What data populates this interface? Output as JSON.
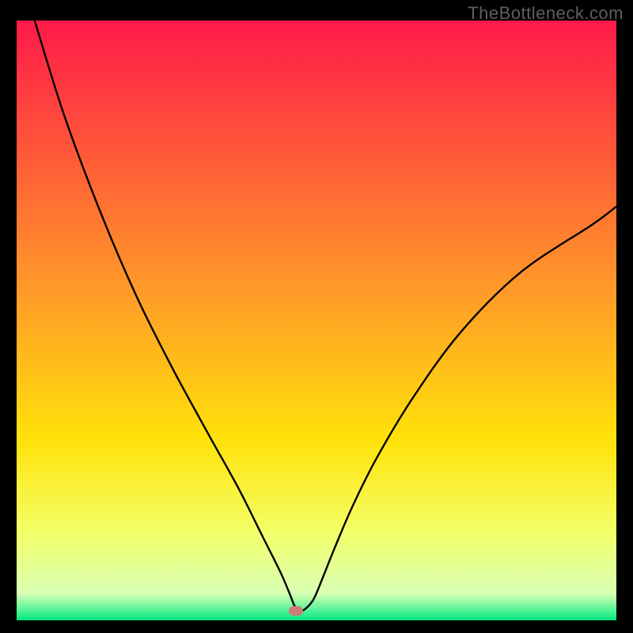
{
  "watermark": "TheBottleneck.com",
  "chart_data": {
    "type": "line",
    "title": "",
    "xlabel": "",
    "ylabel": "",
    "xlim": [
      0,
      100
    ],
    "ylim": [
      0,
      100
    ],
    "grid": false,
    "gradient_stops": [
      {
        "offset": 0,
        "color": "#ff1a49"
      },
      {
        "offset": 0.45,
        "color": "#ff9a28"
      },
      {
        "offset": 0.7,
        "color": "#ffe20a"
      },
      {
        "offset": 0.85,
        "color": "#f4ff66"
      },
      {
        "offset": 0.955,
        "color": "#d8ffb4"
      },
      {
        "offset": 0.985,
        "color": "#4bf296"
      },
      {
        "offset": 1.0,
        "color": "#00e47a"
      }
    ],
    "series": [
      {
        "name": "bottleneck-curve",
        "color": "#000000",
        "x": [
          3.0,
          8,
          14,
          20,
          26,
          32,
          37,
          41,
          44,
          45.5,
          46.3,
          47.0,
          48,
          49.5,
          51,
          53,
          56,
          60,
          66,
          74,
          84,
          96,
          100
        ],
        "values": [
          100,
          84,
          68,
          54,
          42,
          31,
          22,
          14,
          8,
          4.5,
          2.5,
          1.6,
          1.8,
          3.5,
          7,
          12,
          19,
          27,
          37,
          48,
          58,
          66,
          69
        ]
      }
    ],
    "marker": {
      "x": 46.6,
      "y": 1.6,
      "color": "#cf7a78"
    }
  }
}
